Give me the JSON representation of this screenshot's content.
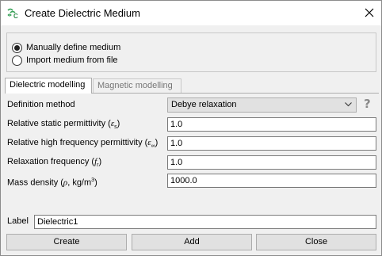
{
  "window": {
    "title": "Create Dielectric Medium",
    "app_icon": "cst-logo-icon",
    "close_icon": "close-icon"
  },
  "source": {
    "options": [
      {
        "label": "Manually define medium",
        "checked": true
      },
      {
        "label": "Import medium from file",
        "checked": false
      }
    ]
  },
  "tabs": [
    {
      "label": "Dielectric modelling",
      "active": true
    },
    {
      "label": "Magnetic modelling",
      "active": false
    }
  ],
  "dielectric": {
    "definition_method": {
      "label": "Definition method",
      "value": "Debye relaxation",
      "help_icon": "question-mark-icon"
    },
    "fields": [
      {
        "label": "Relative static permittivity (",
        "symbol": "ε",
        "sub": "s",
        "suffix": ")",
        "value": "1.0"
      },
      {
        "label": "Relative high frequency permittivity (",
        "symbol": "ε",
        "sub": "∞",
        "suffix": ")",
        "value": "1.0"
      },
      {
        "label": "Relaxation frequency (",
        "symbol": "f",
        "sub": "r",
        "suffix": ")",
        "value": "1.0"
      },
      {
        "label": "Mass density (",
        "symbol": "ρ",
        "sub": "",
        "suffix": ", kg/m",
        "sup": "3",
        "suffix2": ")",
        "value": "1000.0"
      }
    ]
  },
  "label_field": {
    "label": "Label",
    "value": "Dielectric1"
  },
  "buttons": {
    "create": "Create",
    "add": "Add",
    "close": "Close"
  }
}
